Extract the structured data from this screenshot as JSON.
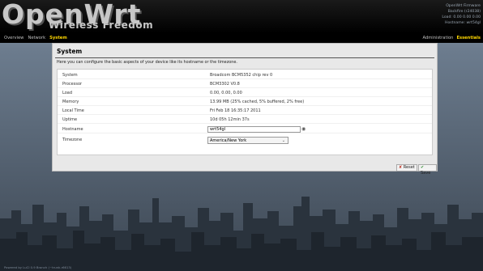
{
  "header": {
    "logo_main": "OpenWrt",
    "logo_sub": "Wireless Freedom",
    "info_lines": [
      "OpenWrt Firmware",
      "Backfire (r24038)",
      "Load: 0.00 0.00 0.00",
      "Hostname: wrt54gl"
    ]
  },
  "menu": {
    "left": [
      "Overview",
      "Network",
      "System"
    ],
    "left_active": "System",
    "right": [
      "Administration",
      "Essentials"
    ],
    "right_active": "Essentials"
  },
  "page": {
    "title": "System",
    "description": "Here you can configure the basic aspects of your device like its hostname or the timezone."
  },
  "fields": [
    {
      "label": "System",
      "value": "Broadcom BCM5352 chip rev 0"
    },
    {
      "label": "Processor",
      "value": "BCM3302 V0.8"
    },
    {
      "label": "Load",
      "value": "0.00, 0.00, 0.00"
    },
    {
      "label": "Memory",
      "value": "13.99 MB (25% cached, 5% buffered, 2% free)"
    },
    {
      "label": "Local Time",
      "value": "Fri Feb 18 16:35:17 2011"
    },
    {
      "label": "Uptime",
      "value": "10d 05h 12min 37s"
    }
  ],
  "hostname": {
    "label": "Hostname",
    "value": "wrt54gl"
  },
  "timezone": {
    "label": "Timezone",
    "value": "America/New York"
  },
  "buttons": {
    "reset": "Reset",
    "save": "Save"
  },
  "footer": {
    "text": "Powered by LuCI 0.9 Branch (~trunk-r6613)"
  },
  "icons": {
    "hostname_action": "sync-icon",
    "timezone_dropdown": "chevron-down-icon",
    "reset": "reset-icon",
    "save": "save-icon"
  },
  "colors": {
    "menu_active": "#ffd700",
    "reset_icon": "#c0392b",
    "save_icon": "#2e8b2e"
  }
}
